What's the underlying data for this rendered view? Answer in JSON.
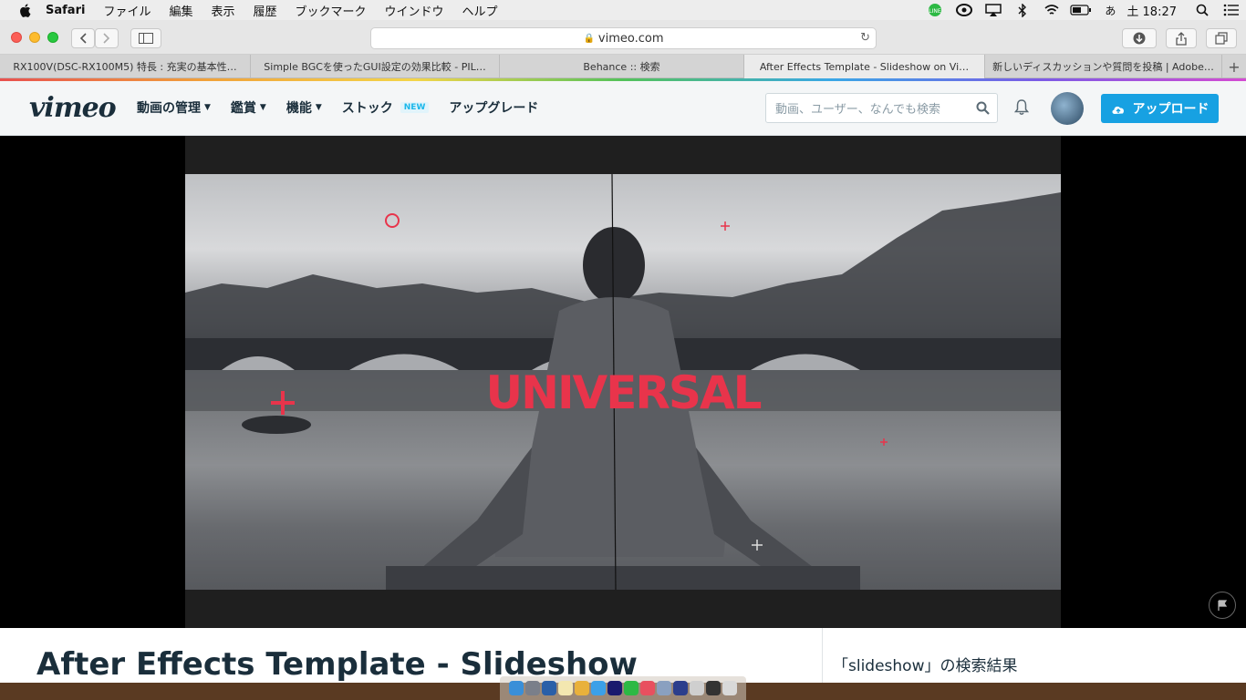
{
  "menubar": {
    "app_name": "Safari",
    "items": [
      "ファイル",
      "編集",
      "表示",
      "履歴",
      "ブックマーク",
      "ウインドウ",
      "ヘルプ"
    ],
    "ime": "あ",
    "clock": "土 18:27"
  },
  "browser": {
    "address": "vimeo.com",
    "tabs": [
      {
        "label": "RX100V(DSC-RX100M5) 特長 : 充実の基本性…",
        "active": false
      },
      {
        "label": "Simple BGCを使ったGUI設定の効果比較 - PIL…",
        "active": false
      },
      {
        "label": "Behance :: 検索",
        "active": false
      },
      {
        "label": "After Effects Template - Slideshow on Vi…",
        "active": true
      },
      {
        "label": "新しいディスカッションや質問を投稿 | Adobe…",
        "active": false
      }
    ],
    "new_tab": "+"
  },
  "vimeo": {
    "logo": "vimeo",
    "nav": [
      {
        "label": "動画の管理",
        "has_dropdown": true
      },
      {
        "label": "鑑賞",
        "has_dropdown": true
      },
      {
        "label": "機能",
        "has_dropdown": true
      },
      {
        "label": "ストック",
        "badge": "NEW"
      },
      {
        "label": "アップグレード"
      }
    ],
    "search_placeholder": "動画、ユーザー、なんでも検索",
    "upload_label": "アップロード"
  },
  "player": {
    "overlay_text": "UNIVERSAL"
  },
  "video": {
    "title": "After Effects Template - Slideshow"
  },
  "sidebar": {
    "results_title": "「slideshow」の検索結果"
  },
  "colors": {
    "accent_blue": "#17a1e2",
    "overlay_red": "#e8344b",
    "logo_dark": "#1a2e3b"
  }
}
